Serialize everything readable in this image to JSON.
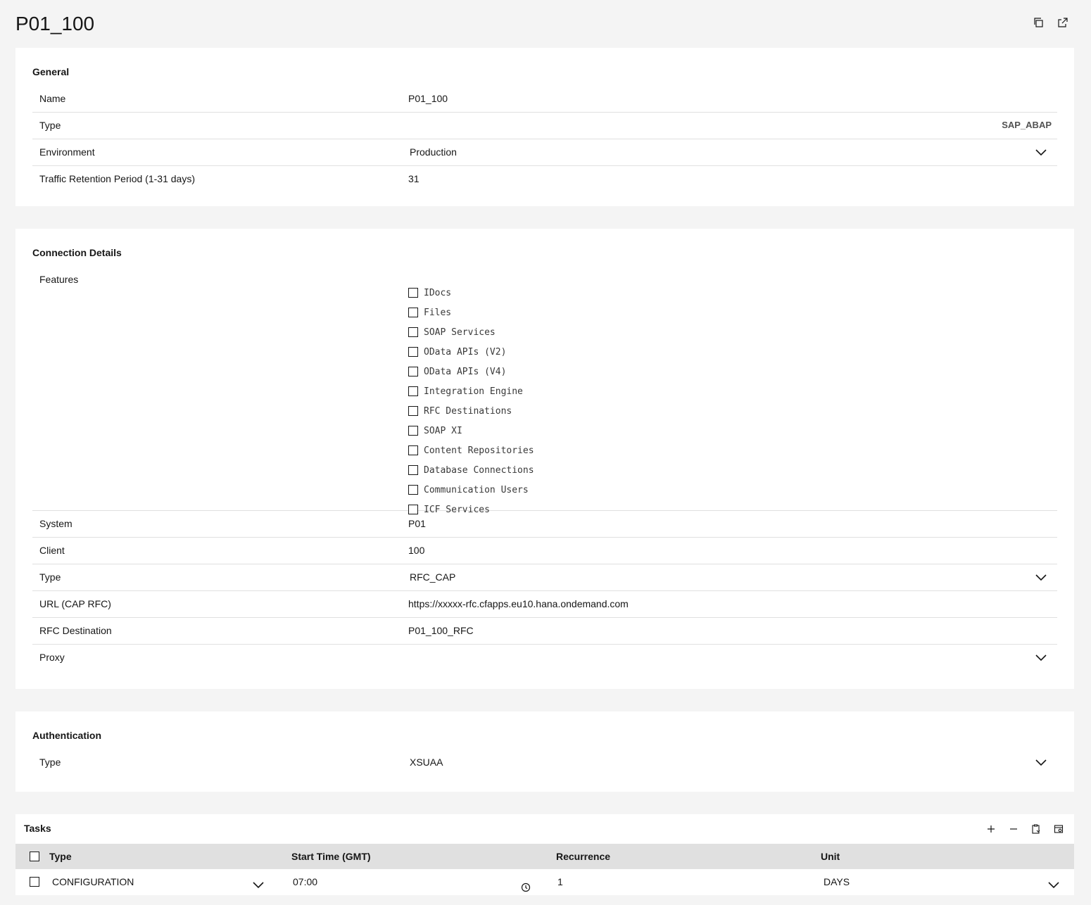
{
  "page": {
    "title": "P01_100"
  },
  "top_actions": {
    "copy": "copy-icon",
    "open": "launch-icon"
  },
  "general": {
    "title": "General",
    "name_label": "Name",
    "name_value": "P01_100",
    "type_label": "Type",
    "type_value": "SAP_ABAP",
    "env_label": "Environment",
    "env_value": "Production",
    "retention_label": "Traffic Retention Period (1-31 days)",
    "retention_value": "31"
  },
  "connection": {
    "title": "Connection Details",
    "features_label": "Features",
    "features": [
      "IDocs",
      "Files",
      "SOAP Services",
      "OData APIs (V2)",
      "OData APIs (V4)",
      "Integration Engine",
      "RFC Destinations",
      "SOAP XI",
      "Content Repositories",
      "Database Connections",
      "Communication Users",
      "ICF Services"
    ],
    "system_label": "System",
    "system_value": "P01",
    "client_label": "Client",
    "client_value": "100",
    "type_label": "Type",
    "type_value": "RFC_CAP",
    "url_label": "URL (CAP RFC)",
    "url_value": "https://xxxxx-rfc.cfapps.eu10.hana.ondemand.com",
    "rfc_label": "RFC Destination",
    "rfc_value": "P01_100_RFC",
    "proxy_label": "Proxy",
    "proxy_value": ""
  },
  "authentication": {
    "title": "Authentication",
    "type_label": "Type",
    "type_value": "XSUAA"
  },
  "tasks": {
    "title": "Tasks",
    "columns": {
      "type": "Type",
      "start": "Start Time (GMT)",
      "recurrence": "Recurrence",
      "unit": "Unit"
    },
    "rows": [
      {
        "type": "CONFIGURATION",
        "start": "07:00",
        "recurrence": "1",
        "unit": "DAYS"
      }
    ]
  }
}
